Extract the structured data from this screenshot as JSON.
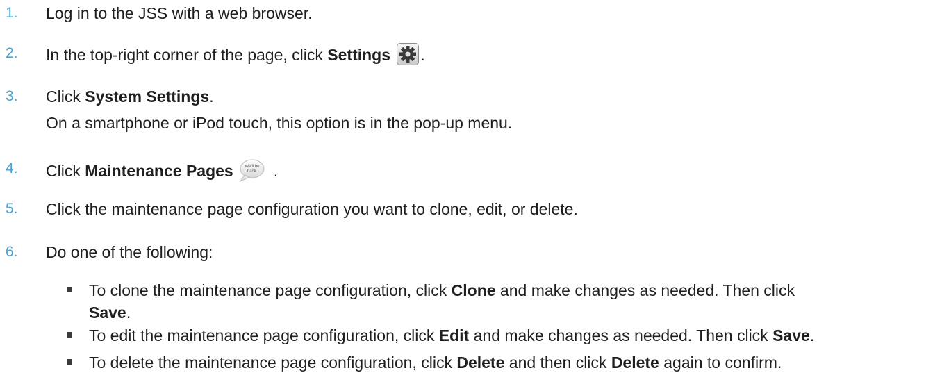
{
  "steps": [
    {
      "num": "1.",
      "text": "Log in to the JSS with a web browser."
    },
    {
      "num": "2.",
      "pre": "In the top-right corner of the page, click ",
      "bold": "Settings",
      "post": "."
    },
    {
      "num": "3.",
      "pre": "Click ",
      "bold": "System Settings",
      "post": ".",
      "note": "On a smartphone or iPod touch, this option is in the pop-up menu."
    },
    {
      "num": "4.",
      "pre": "Click ",
      "bold": "Maintenance Pages",
      "post": ".",
      "icon_text": "We'll be back."
    },
    {
      "num": "5.",
      "text": "Click the maintenance page configuration you want to clone, edit, or delete."
    },
    {
      "num": "6.",
      "text": "Do one of the following:"
    }
  ],
  "bullets": [
    {
      "pre": "To clone the maintenance page configuration, click ",
      "b1": "Clone",
      "mid": " and make changes as needed. Then click",
      "b2": "Save",
      "post": "."
    },
    {
      "pre": "To edit the maintenance page configuration, click ",
      "b1": "Edit",
      "mid": " and make changes as needed. Then click ",
      "b2": "Save",
      "post": "."
    },
    {
      "pre": "To delete the maintenance page configuration, click ",
      "b1": "Delete",
      "mid": " and then click ",
      "b2": "Delete",
      "post": " again to confirm."
    }
  ],
  "icons": {
    "gear": "gear-icon",
    "bubble": "speech-bubble-icon"
  }
}
